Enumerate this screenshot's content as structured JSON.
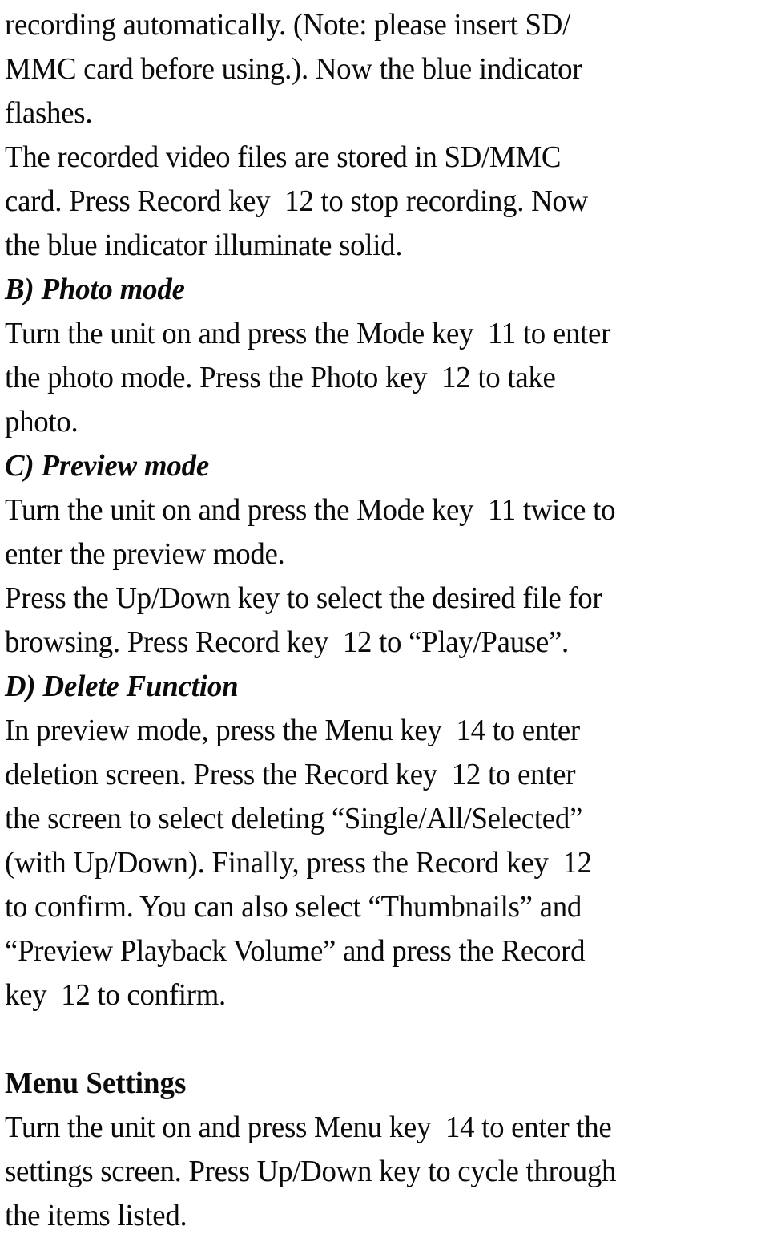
{
  "document": {
    "page_kind": "scanned-manual-page",
    "background_color": "#ffffff",
    "text_color": "#0b0b0b",
    "lines": [
      {
        "id": "l01",
        "style": "body",
        "text": "recording automatically. (Note: please insert SD/"
      },
      {
        "id": "l02",
        "style": "body",
        "text": "MMC card before using.). Now the blue indicator"
      },
      {
        "id": "l03",
        "style": "body",
        "text": "flashes."
      },
      {
        "id": "l04",
        "style": "body",
        "text": "The recorded video files are stored in SD/MMC"
      },
      {
        "id": "l05",
        "style": "body",
        "text": "card. Press Record key  12 to stop recording. Now"
      },
      {
        "id": "l06",
        "style": "body",
        "text": "the blue indicator illuminate solid."
      },
      {
        "id": "l07",
        "style": "heading-italic",
        "text": "B) Photo mode"
      },
      {
        "id": "l08",
        "style": "body",
        "text": "Turn the unit on and press the Mode key  11 to enter"
      },
      {
        "id": "l09",
        "style": "body",
        "text": "the photo mode. Press the Photo key  12 to take"
      },
      {
        "id": "l10",
        "style": "body",
        "text": "photo."
      },
      {
        "id": "l11",
        "style": "heading-italic",
        "text": "C) Preview mode"
      },
      {
        "id": "l12",
        "style": "body",
        "text": "Turn the unit on and press the Mode key  11 twice to"
      },
      {
        "id": "l13",
        "style": "body",
        "text": "enter the preview mode."
      },
      {
        "id": "l14",
        "style": "body",
        "text": "Press the Up/Down key to select the desired file for"
      },
      {
        "id": "l15",
        "style": "body",
        "text": "browsing. Press Record key  12 to “Play/Pause”."
      },
      {
        "id": "l16",
        "style": "heading-italic",
        "text": "D) Delete Function"
      },
      {
        "id": "l17",
        "style": "body",
        "text": "In preview mode, press the Menu key  14 to enter"
      },
      {
        "id": "l18",
        "style": "body",
        "text": "deletion screen. Press the Record key  12 to enter"
      },
      {
        "id": "l19",
        "style": "body",
        "text": "the screen to select deleting “Single/All/Selected”"
      },
      {
        "id": "l20",
        "style": "body",
        "text": "(with Up/Down). Finally, press the Record key  12"
      },
      {
        "id": "l21",
        "style": "body",
        "text": "to confirm. You can also select “Thumbnails” and"
      },
      {
        "id": "l22",
        "style": "body",
        "text": "“Preview Playback Volume” and press the Record"
      },
      {
        "id": "l23",
        "style": "body",
        "text": "key  12 to confirm."
      },
      {
        "id": "l24",
        "style": "spacer",
        "text": ""
      },
      {
        "id": "l25",
        "style": "heading-bold",
        "text": "Menu Settings"
      },
      {
        "id": "l26",
        "style": "body",
        "text": "Turn the unit on and press Menu key  14 to enter the"
      },
      {
        "id": "l27",
        "style": "body",
        "text": "settings screen. Press Up/Down key to cycle through"
      },
      {
        "id": "l28",
        "style": "body",
        "text": "the items listed."
      }
    ],
    "sections": [
      {
        "label": "B) Photo mode"
      },
      {
        "label": "C) Preview mode"
      },
      {
        "label": "D) Delete Function"
      },
      {
        "label": "Menu Settings"
      }
    ],
    "referenced_keys": [
      {
        "name": "Record key",
        "number": "12"
      },
      {
        "name": "Photo key",
        "number": "12"
      },
      {
        "name": "Mode key",
        "number": "11"
      },
      {
        "name": "Menu key",
        "number": "14"
      },
      {
        "name": "Up/Down key",
        "number": ""
      }
    ]
  }
}
